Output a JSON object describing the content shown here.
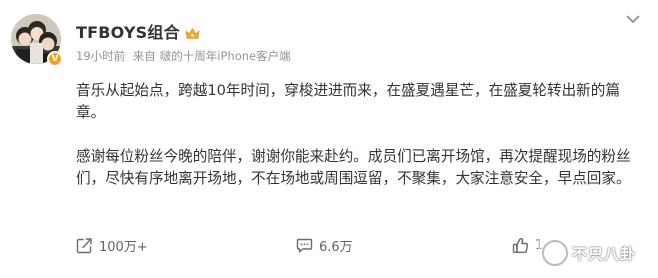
{
  "post": {
    "author": {
      "name": "TFBOYS组合",
      "badge_color": "#f7a21b"
    },
    "meta": {
      "time": "19小时前",
      "from_label": "来自",
      "device": "啵的十周年iPhone客户端"
    },
    "content": {
      "paragraphs": [
        "音乐从起始点，跨越10年时间，穿梭进进而来，在盛夏遇星芒，在盛夏轮转出新的篇章。",
        "感谢每位粉丝今晚的陪伴，谢谢你能来赴约。成员们已离开场馆，再次提醒现场的粉丝们，尽快有序地离开场地，不在场地或周围逗留，不聚集，大家注意安全，早点回家。"
      ]
    },
    "actions": {
      "repost_count": "100万+",
      "comment_count": "6.6万",
      "like_count": "1"
    },
    "watermark": {
      "text": "不只八卦"
    },
    "icons": {
      "repost": "share-square-icon",
      "comment": "comment-icon",
      "like": "thumbs-up-icon",
      "more": "chevron-down-icon",
      "crown": "crown-icon"
    }
  }
}
